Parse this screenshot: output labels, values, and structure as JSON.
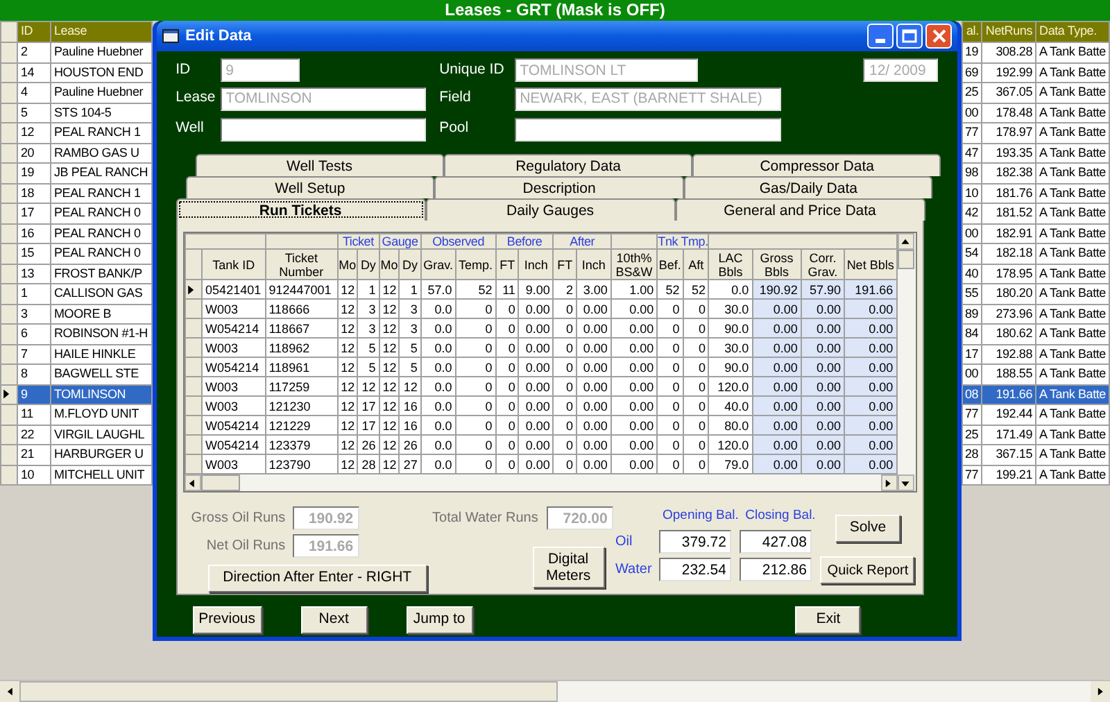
{
  "app": {
    "title": "Leases - GRT (Mask is OFF)"
  },
  "leases": {
    "columns": [
      "ID",
      "Lease",
      "al.",
      "NetRuns",
      "Data Type."
    ],
    "rows": [
      {
        "id": "2",
        "lease": "Pauline Huebner",
        "column_3": "19",
        "net_runs": "308.28",
        "data_type": "A Tank Batte",
        "selected": false
      },
      {
        "id": "14",
        "lease": "HOUSTON END",
        "column_3": "69",
        "net_runs": "192.99",
        "data_type": "A Tank Batte",
        "selected": false
      },
      {
        "id": "4",
        "lease": "Pauline Huebner",
        "column_3": "25",
        "net_runs": "367.05",
        "data_type": "A Tank Batte",
        "selected": false
      },
      {
        "id": "5",
        "lease": "STS 104-5",
        "column_3": "00",
        "net_runs": "178.48",
        "data_type": "A Tank Batte",
        "selected": false
      },
      {
        "id": "12",
        "lease": "PEAL RANCH 1",
        "column_3": "77",
        "net_runs": "178.97",
        "data_type": "A Tank Batte",
        "selected": false
      },
      {
        "id": "20",
        "lease": "RAMBO GAS U",
        "column_3": "47",
        "net_runs": "193.35",
        "data_type": "A Tank Batte",
        "selected": false
      },
      {
        "id": "19",
        "lease": "JB PEAL RANCH",
        "column_3": "98",
        "net_runs": "182.38",
        "data_type": "A Tank Batte",
        "selected": false
      },
      {
        "id": "18",
        "lease": "PEAL RANCH 1",
        "column_3": "10",
        "net_runs": "181.76",
        "data_type": "A Tank Batte",
        "selected": false
      },
      {
        "id": "17",
        "lease": "PEAL RANCH 0",
        "column_3": "42",
        "net_runs": "181.52",
        "data_type": "A Tank Batte",
        "selected": false
      },
      {
        "id": "16",
        "lease": "PEAL RANCH 0",
        "column_3": "00",
        "net_runs": "182.91",
        "data_type": "A Tank Batte",
        "selected": false
      },
      {
        "id": "15",
        "lease": "PEAL RANCH 0",
        "column_3": "54",
        "net_runs": "182.18",
        "data_type": "A Tank Batte",
        "selected": false
      },
      {
        "id": "13",
        "lease": "FROST BANK/P",
        "column_3": "40",
        "net_runs": "178.95",
        "data_type": "A Tank Batte",
        "selected": false
      },
      {
        "id": "1",
        "lease": "CALLISON GAS",
        "column_3": "55",
        "net_runs": "180.20",
        "data_type": "A Tank Batte",
        "selected": false
      },
      {
        "id": "3",
        "lease": "MOORE B",
        "column_3": "89",
        "net_runs": "273.96",
        "data_type": "A Tank Batte",
        "selected": false
      },
      {
        "id": "6",
        "lease": "ROBINSON #1-H",
        "column_3": "84",
        "net_runs": "180.62",
        "data_type": "A Tank Batte",
        "selected": false
      },
      {
        "id": "7",
        "lease": "HAILE HINKLE",
        "column_3": "17",
        "net_runs": "192.88",
        "data_type": "A Tank Batte",
        "selected": false
      },
      {
        "id": "8",
        "lease": "BAGWELL STE",
        "column_3": "00",
        "net_runs": "188.55",
        "data_type": "A Tank Batte",
        "selected": false
      },
      {
        "id": "9",
        "lease": "TOMLINSON",
        "column_3": "08",
        "net_runs": "191.66",
        "data_type": "A Tank Batte",
        "selected": true
      },
      {
        "id": "11",
        "lease": "M.FLOYD UNIT",
        "column_3": "77",
        "net_runs": "192.44",
        "data_type": "A Tank Batte",
        "selected": false
      },
      {
        "id": "22",
        "lease": "VIRGIL LAUGHL",
        "column_3": "25",
        "net_runs": "171.49",
        "data_type": "A Tank Batte",
        "selected": false
      },
      {
        "id": "21",
        "lease": "HARBURGER U",
        "column_3": "28",
        "net_runs": "367.15",
        "data_type": "A Tank Batte",
        "selected": false
      },
      {
        "id": "10",
        "lease": "MITCHELL UNIT",
        "column_3": "77",
        "net_runs": "199.21",
        "data_type": "A Tank Batte",
        "selected": false
      }
    ]
  },
  "dialog": {
    "title": "Edit Data",
    "fields": [
      {
        "label": "ID",
        "value": "9"
      },
      {
        "label": "Unique ID",
        "value": "TOMLINSON LT"
      },
      {
        "label": "Lease",
        "value": "TOMLINSON"
      },
      {
        "label": "Field",
        "value": "NEWARK, EAST (BARNETT SHALE)"
      },
      {
        "label": "Well"
      },
      {
        "label": "Pool"
      }
    ],
    "date": "12/ 2009",
    "tab_rows": [
      [
        {
          "label": "Well Tests",
          "selected": false
        },
        {
          "label": "Regulatory Data",
          "selected": false
        },
        {
          "label": "Compressor Data",
          "selected": false
        }
      ],
      [
        {
          "label": "Well Setup",
          "selected": false
        },
        {
          "label": "Description",
          "selected": false
        },
        {
          "label": "Gas/Daily Data",
          "selected": false
        }
      ],
      [
        {
          "label": "Run Tickets",
          "selected": true
        },
        {
          "label": "Daily Gauges",
          "selected": false
        },
        {
          "label": "General and Price Data",
          "selected": false
        }
      ]
    ],
    "grid": {
      "groups": [
        "Ticket",
        "Gauge",
        "Observed",
        "Before",
        "After",
        "Tnk Tmp."
      ],
      "columns": [
        "Tank ID",
        "Ticket Number",
        "Mo",
        "Dy",
        "Mo",
        "Dy",
        "Grav.",
        "Temp.",
        "FT",
        "Inch",
        "FT",
        "Inch",
        "10th% BS&W",
        "Bef.",
        "Aft",
        "LAC Bbls",
        "Gross Bbls",
        "Corr. Grav.",
        "Net Bbls"
      ],
      "rows": [
        {
          "selected": true,
          "cells": [
            "05421401",
            "912447001",
            "12",
            "1",
            "12",
            "1",
            "57.0",
            "52",
            "11",
            "9.00",
            "2",
            "3.00",
            "1.00",
            "52",
            "52",
            "0.0",
            "190.92",
            "57.90",
            "191.66"
          ]
        },
        {
          "selected": false,
          "cells": [
            "W003",
            "118666",
            "12",
            "3",
            "12",
            "3",
            "0.0",
            "0",
            "0",
            "0.00",
            "0",
            "0.00",
            "0.00",
            "0",
            "0",
            "30.0",
            "0.00",
            "0.00",
            "0.00"
          ]
        },
        {
          "selected": false,
          "cells": [
            "W054214",
            "118667",
            "12",
            "3",
            "12",
            "3",
            "0.0",
            "0",
            "0",
            "0.00",
            "0",
            "0.00",
            "0.00",
            "0",
            "0",
            "90.0",
            "0.00",
            "0.00",
            "0.00"
          ]
        },
        {
          "selected": false,
          "cells": [
            "W003",
            "118962",
            "12",
            "5",
            "12",
            "5",
            "0.0",
            "0",
            "0",
            "0.00",
            "0",
            "0.00",
            "0.00",
            "0",
            "0",
            "30.0",
            "0.00",
            "0.00",
            "0.00"
          ]
        },
        {
          "selected": false,
          "cells": [
            "W054214",
            "118961",
            "12",
            "5",
            "12",
            "5",
            "0.0",
            "0",
            "0",
            "0.00",
            "0",
            "0.00",
            "0.00",
            "0",
            "0",
            "90.0",
            "0.00",
            "0.00",
            "0.00"
          ]
        },
        {
          "selected": false,
          "cells": [
            "W003",
            "117259",
            "12",
            "12",
            "12",
            "12",
            "0.0",
            "0",
            "0",
            "0.00",
            "0",
            "0.00",
            "0.00",
            "0",
            "0",
            "120.0",
            "0.00",
            "0.00",
            "0.00"
          ]
        },
        {
          "selected": false,
          "cells": [
            "W003",
            "121230",
            "12",
            "17",
            "12",
            "16",
            "0.0",
            "0",
            "0",
            "0.00",
            "0",
            "0.00",
            "0.00",
            "0",
            "0",
            "40.0",
            "0.00",
            "0.00",
            "0.00"
          ]
        },
        {
          "selected": false,
          "cells": [
            "W054214",
            "121229",
            "12",
            "17",
            "12",
            "16",
            "0.0",
            "0",
            "0",
            "0.00",
            "0",
            "0.00",
            "0.00",
            "0",
            "0",
            "80.0",
            "0.00",
            "0.00",
            "0.00"
          ]
        },
        {
          "selected": false,
          "cells": [
            "W054214",
            "123379",
            "12",
            "26",
            "12",
            "26",
            "0.0",
            "0",
            "0",
            "0.00",
            "0",
            "0.00",
            "0.00",
            "0",
            "0",
            "120.0",
            "0.00",
            "0.00",
            "0.00"
          ]
        },
        {
          "selected": false,
          "cells": [
            "W003",
            "123790",
            "12",
            "28",
            "12",
            "27",
            "0.0",
            "0",
            "0",
            "0.00",
            "0",
            "0.00",
            "0.00",
            "0",
            "0",
            "79.0",
            "0.00",
            "0.00",
            "0.00"
          ]
        }
      ]
    },
    "runs": [
      {
        "label": "Gross Oil Runs",
        "value": "190.92"
      },
      {
        "label": "Net Oil Runs",
        "value": "191.66"
      },
      {
        "label": "Total Water Runs",
        "value": "720.00"
      }
    ],
    "direction_button": "Direction After Enter - RIGHT",
    "meters_button": "Digital Meters",
    "balances": {
      "headers": [
        "Opening Bal.",
        "Closing Bal."
      ],
      "rows": [
        {
          "label": "Oil",
          "values": [
            "379.72",
            "427.08"
          ]
        },
        {
          "label": "Water",
          "values": [
            "232.54",
            "212.86"
          ]
        }
      ]
    },
    "panel_buttons": [
      "Solve",
      "Quick Report"
    ],
    "nav_buttons": [
      "Previous",
      "Next",
      "Jump to"
    ],
    "exit_button": "Exit"
  }
}
